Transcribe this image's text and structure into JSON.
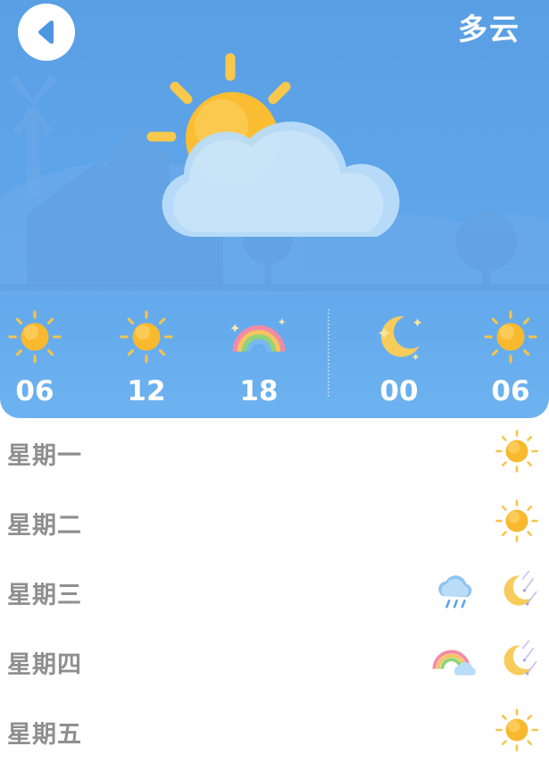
{
  "header": {
    "condition": "多云",
    "icons": {
      "back": "back-arrow-icon",
      "main": "partly-cloudy-icon"
    }
  },
  "hourly": [
    {
      "time": "06",
      "icon": "sun-icon"
    },
    {
      "time": "12",
      "icon": "sun-icon"
    },
    {
      "time": "18",
      "icon": "rainbow-icon"
    },
    {
      "time": "00",
      "icon": "moon-icon"
    },
    {
      "time": "06",
      "icon": "sun-icon"
    }
  ],
  "daily": [
    {
      "day": "星期一",
      "icons": [
        "sun-icon"
      ]
    },
    {
      "day": "星期二",
      "icons": [
        "sun-icon"
      ]
    },
    {
      "day": "星期三",
      "icons": [
        "rain-cloud-icon",
        "moon-meteor-icon"
      ]
    },
    {
      "day": "星期四",
      "icons": [
        "rainbow-cloud-icon",
        "moon-meteor-icon"
      ]
    },
    {
      "day": "星期五",
      "icons": [
        "sun-icon"
      ]
    }
  ],
  "colors": {
    "sky": "#5fa6ea",
    "sun": "#f9b92e",
    "day_text": "#8f8f8f"
  }
}
